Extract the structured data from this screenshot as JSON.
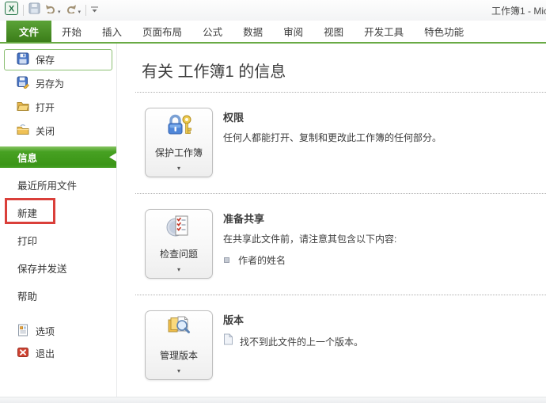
{
  "window": {
    "title": "工作簿1 - Mic"
  },
  "tabs": {
    "file": "文件",
    "others": [
      "开始",
      "插入",
      "页面布局",
      "公式",
      "数据",
      "审阅",
      "视图",
      "开发工具",
      "特色功能"
    ]
  },
  "sidebar": {
    "save": "保存",
    "save_as": "另存为",
    "open": "打开",
    "close": "关闭",
    "info": "信息",
    "recent": "最近所用文件",
    "new": "新建",
    "print": "打印",
    "save_send": "保存并发送",
    "help": "帮助",
    "options": "选项",
    "exit": "退出"
  },
  "content": {
    "title": "有关 工作簿1 的信息",
    "permission": {
      "button": "保护工作簿",
      "heading": "权限",
      "desc": "任何人都能打开、复制和更改此工作簿的任何部分。"
    },
    "share": {
      "button": "检查问题",
      "heading": "准备共享",
      "desc": "在共享此文件前，请注意其包含以下内容:",
      "bullet": "作者的姓名"
    },
    "versions": {
      "button": "管理版本",
      "heading": "版本",
      "note": "找不到此文件的上一个版本。"
    }
  },
  "colors": {
    "file_tab_green": "#3b7d19",
    "selected_item_green": "#47a122",
    "tab_underline_green": "#69aa45",
    "annotation_red": "#da3f3a"
  }
}
